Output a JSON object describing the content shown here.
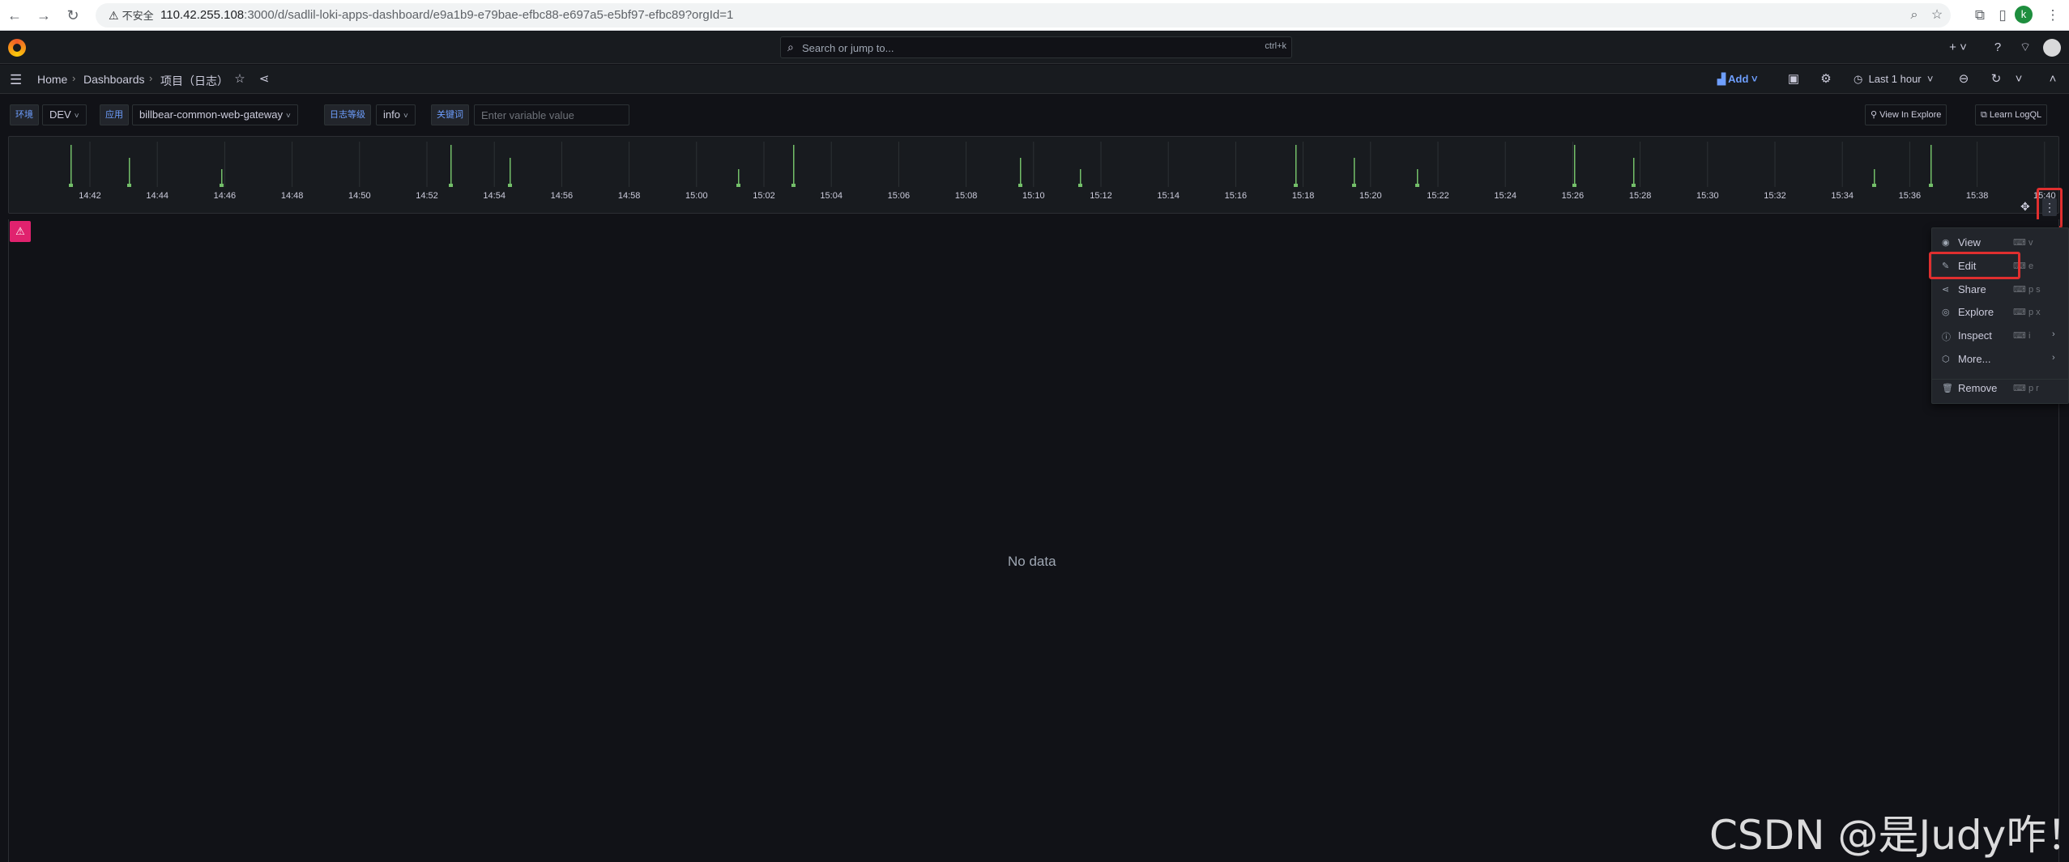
{
  "browser": {
    "insecure_label": "不安全",
    "url_host": "110.42.255.108",
    "url_rest": ":3000/d/sadlil-loki-apps-dashboard/e9a1b9-e79bae-efbc88-e697a5-e5bf97-efbc89?orgId=1",
    "profile_initial": "k"
  },
  "grafana": {
    "search_placeholder": "Search or jump to...",
    "search_shortcut": "ctrl+k",
    "breadcrumbs": [
      "Home",
      "Dashboards",
      "项目（日志）"
    ],
    "add_label": "Add",
    "time_range": "Last 1 hour"
  },
  "variables": [
    {
      "label": "环境",
      "value": "DEV"
    },
    {
      "label": "应用",
      "value": "billbear-common-web-gateway"
    },
    {
      "label": "日志等级",
      "value": "info"
    },
    {
      "label": "关键词",
      "placeholder": "Enter variable value"
    }
  ],
  "toolbar_links": {
    "view_in_explore": "View In Explore",
    "learn_logql": "Learn LogQL"
  },
  "histogram": {
    "x_ticks": [
      "14:42",
      "14:44",
      "14:46",
      "14:48",
      "14:50",
      "14:52",
      "14:54",
      "14:56",
      "14:58",
      "15:00",
      "15:02",
      "15:04",
      "15:06",
      "15:08",
      "15:10",
      "15:12",
      "15:14",
      "15:16",
      "15:18",
      "15:20",
      "15:22",
      "15:24",
      "15:26",
      "15:28",
      "15:30",
      "15:32",
      "15:34",
      "15:36",
      "15:38",
      "15:40"
    ],
    "bar_color": "#73bf69"
  },
  "logs_panel": {
    "empty_text": "No data"
  },
  "panel_menu": {
    "items": [
      {
        "label": "View",
        "shortcut": "v"
      },
      {
        "label": "Edit",
        "shortcut": "e"
      },
      {
        "label": "Share",
        "shortcut": "p s"
      },
      {
        "label": "Explore",
        "shortcut": "p x"
      },
      {
        "label": "Inspect",
        "shortcut": "i"
      },
      {
        "label": "More...",
        "shortcut": ""
      },
      {
        "label": "Remove",
        "shortcut": "p r"
      }
    ]
  },
  "watermark": "CSDN @是Judy咋！"
}
